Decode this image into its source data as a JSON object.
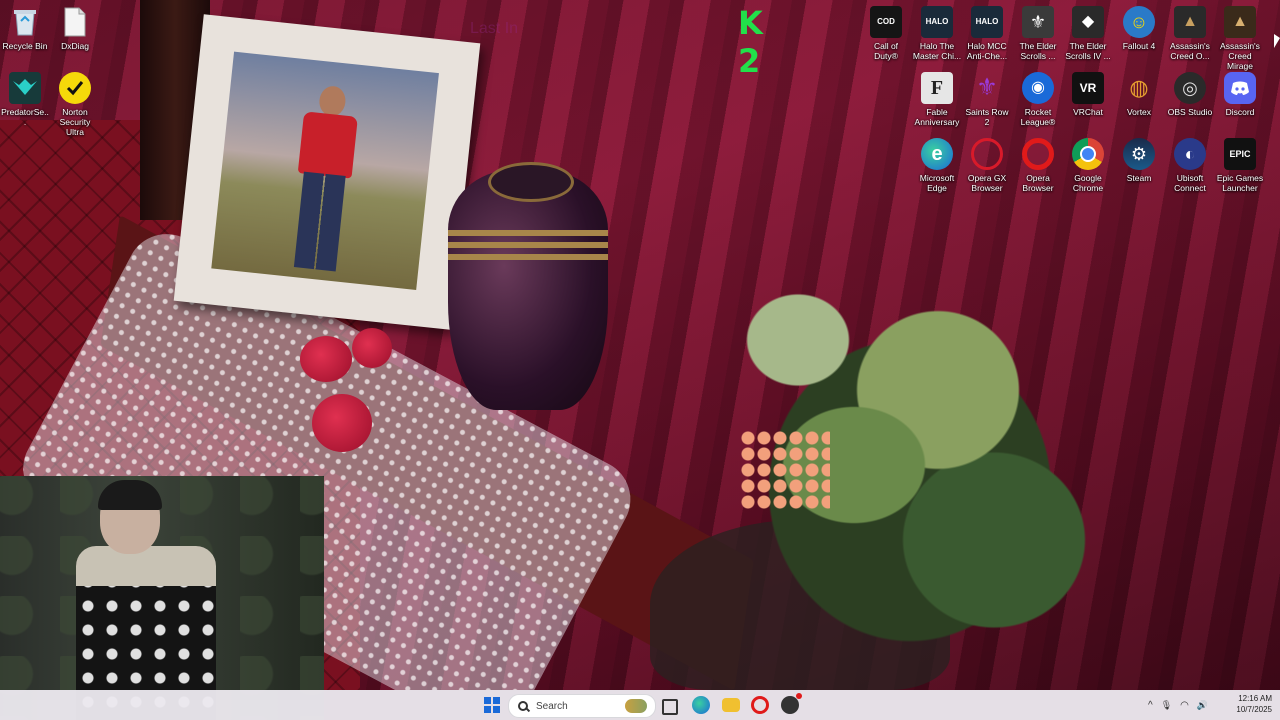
{
  "desktop_icons_left": [
    {
      "id": "recycle-bin",
      "label": "Recycle Bin",
      "icon": "recycle-bin-icon",
      "color": "#c9d6e3"
    },
    {
      "id": "dxdiag",
      "label": "DxDiag",
      "icon": "document-icon",
      "color": "#f2f2f2"
    },
    {
      "id": "predatorsense",
      "label": "PredatorSe...",
      "icon": "predator-icon",
      "color": "#2aa8a8"
    },
    {
      "id": "norton",
      "label": "Norton Security Ultra",
      "icon": "norton-check-icon",
      "color": "#f5d90a"
    }
  ],
  "desktop_icons_right_row1": [
    {
      "id": "call-of-duty",
      "label": "Call of Duty®",
      "glyph": "CALL OF DUTY",
      "color": "#151515"
    },
    {
      "id": "halo-mcc",
      "label": "Halo The Master Chi...",
      "glyph": "HALO",
      "color": "#1a2a3a"
    },
    {
      "id": "halo-mcc-anticheat",
      "label": "Halo MCC Anti-Che...",
      "glyph": "HALO",
      "color": "#1a2a3a"
    },
    {
      "id": "skyrim",
      "label": "The Elder Scrolls ...",
      "glyph": "⚜",
      "color": "#3a3a3a"
    },
    {
      "id": "oblivion",
      "label": "The Elder Scrolls IV ...",
      "glyph": "◆",
      "color": "#2a2a2a"
    },
    {
      "id": "fallout4",
      "label": "Fallout 4",
      "glyph": "☺",
      "color": "#2a7ac8"
    },
    {
      "id": "ac-odyssey",
      "label": "Assassin's Creed O...",
      "glyph": "▲",
      "color": "#2a2a2a"
    },
    {
      "id": "ac-mirage",
      "label": "Assassin's Creed Mirage",
      "glyph": "▲",
      "color": "#3a2a1a"
    }
  ],
  "desktop_icons_right_row2": [
    {
      "id": "fable",
      "label": "Fable Anniversary",
      "glyph": "F",
      "color": "#e6e6e6"
    },
    {
      "id": "saints-row",
      "label": "Saints Row 2",
      "glyph": "⚜",
      "color": "#6a2a9a"
    },
    {
      "id": "rocket-league",
      "label": "Rocket League®",
      "glyph": "◉",
      "color": "#1a6ad8"
    },
    {
      "id": "vrchat",
      "label": "VRChat",
      "glyph": "VR",
      "color": "#111111"
    },
    {
      "id": "vortex",
      "label": "Vortex",
      "glyph": "◍",
      "color": "#e6a030"
    },
    {
      "id": "obs",
      "label": "OBS Studio",
      "glyph": "◎",
      "color": "#2a2a2a"
    },
    {
      "id": "discord",
      "label": "Discord",
      "glyph": "◕",
      "color": "#5865f2"
    }
  ],
  "desktop_icons_right_row3": [
    {
      "id": "edge",
      "label": "Microsoft Edge",
      "glyph": "e",
      "color": "#1a9ad8"
    },
    {
      "id": "opera-gx",
      "label": "Opera GX Browser",
      "glyph": "O",
      "color": "#d81a2a"
    },
    {
      "id": "opera",
      "label": "Opera Browser",
      "glyph": "O",
      "color": "#e01a1a"
    },
    {
      "id": "chrome",
      "label": "Google Chrome",
      "glyph": "●",
      "color": "#dd4a3a"
    },
    {
      "id": "steam",
      "label": "Steam",
      "glyph": "⚙",
      "color": "#1a3a5a"
    },
    {
      "id": "ubisoft",
      "label": "Ubisoft Connect",
      "glyph": "◐",
      "color": "#2a3a8a"
    },
    {
      "id": "epic",
      "label": "Epic Games Launcher",
      "glyph": "EPIC",
      "color": "#111111"
    }
  ],
  "overlay": {
    "k2_text": "K 2",
    "ghost_text": "Last In"
  },
  "taskbar": {
    "search_placeholder": "Search",
    "apps": [
      {
        "name": "task-view-icon",
        "color": "#333333"
      },
      {
        "name": "edge-taskbar-icon",
        "color": "#1a9ad8"
      },
      {
        "name": "file-explorer-icon",
        "color": "#f0c030"
      },
      {
        "name": "opera-taskbar-icon",
        "color": "#e01a1a"
      },
      {
        "name": "chrome-taskbar-icon",
        "color": "#333333"
      }
    ],
    "tray": {
      "chevron": "^",
      "mic": "🎙",
      "wifi": "◠",
      "volume": "🔊",
      "battery": "▭"
    },
    "time": "12:16 AM",
    "date": "10/7/2025"
  },
  "colors": {
    "accent": "#1a6ad8",
    "taskbar_bg": "#ebe8ee"
  }
}
